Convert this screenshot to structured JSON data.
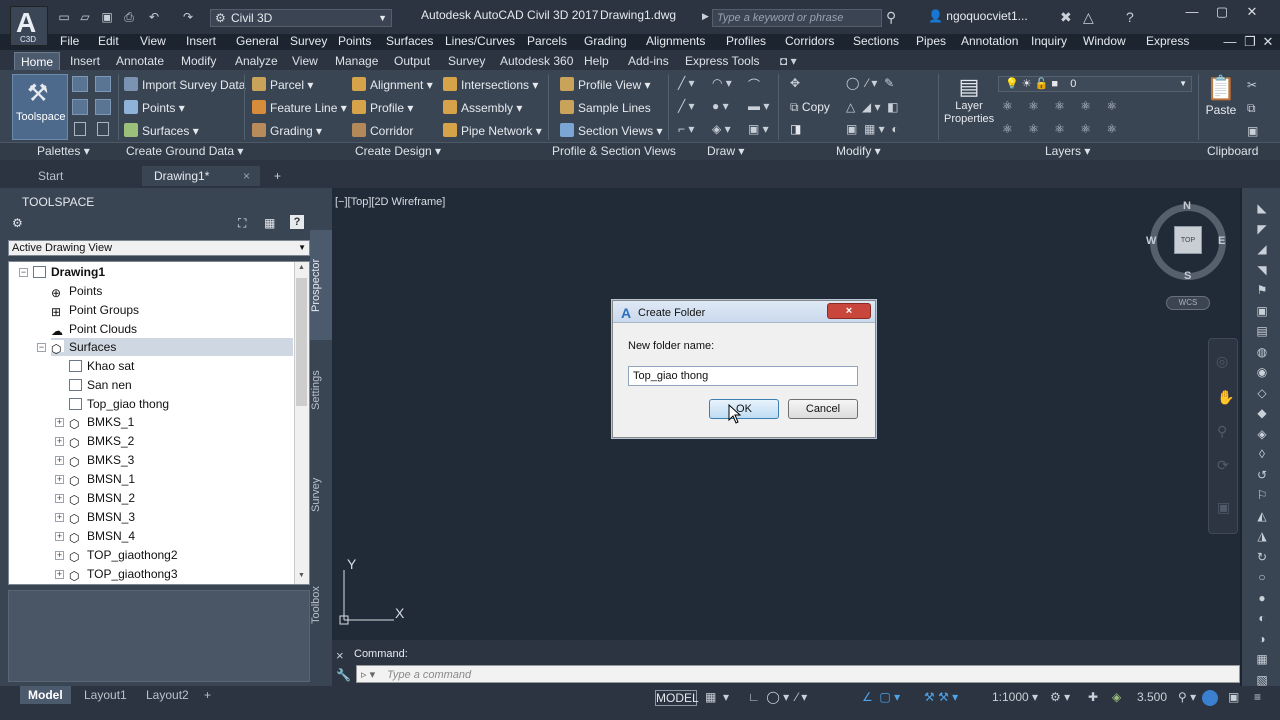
{
  "title": {
    "workspace": "Civil 3D",
    "app": "Autodesk AutoCAD Civil 3D 2017",
    "doc": "Drawing1.dwg",
    "search": "Type a keyword or phrase",
    "user": "ngoquocviet1...",
    "logo": "A",
    "logo_sub": "C3D"
  },
  "menus": [
    "File",
    "Edit",
    "View",
    "Insert",
    "General",
    "Survey",
    "Points",
    "Surfaces",
    "Lines/Curves",
    "Parcels",
    "Grading",
    "Alignments",
    "Profiles",
    "Corridors",
    "Sections",
    "Pipes",
    "Annotation",
    "Inquiry",
    "Window",
    "Express"
  ],
  "ribbon_tabs": [
    "Home",
    "Insert",
    "Annotate",
    "Modify",
    "Analyze",
    "View",
    "Manage",
    "Output",
    "Survey",
    "Autodesk 360",
    "Help",
    "Add-ins",
    "Express Tools"
  ],
  "ribbon": {
    "toolspace": "Toolspace",
    "ground": {
      "import": "Import Survey Data",
      "points": "Points",
      "surfaces": "Surfaces"
    },
    "design": {
      "parcel": "Parcel",
      "feature": "Feature Line",
      "grading": "Grading",
      "alignment": "Alignment",
      "profile": "Profile",
      "corridor": "Corridor",
      "intersections": "Intersections",
      "assembly": "Assembly",
      "pipe": "Pipe Network"
    },
    "profsec": {
      "profile_view": "Profile View",
      "sample": "Sample Lines",
      "section_views": "Section Views"
    },
    "modify": {
      "copy": "Copy"
    },
    "layers": {
      "layer_props": "Layer Properties",
      "layer_value": "0"
    },
    "clipboard": {
      "paste": "Paste"
    },
    "footers": [
      "Palettes",
      "Create Ground Data",
      "Create Design",
      "Profile & Section Views",
      "Draw",
      "Modify",
      "Layers",
      "Clipboard"
    ]
  },
  "doc_tabs": {
    "start": "Start",
    "drawing": "Drawing1*",
    "close": "×",
    "add": "+"
  },
  "toolspace": {
    "title": "TOOLSPACE",
    "view": "Active Drawing View",
    "tree": [
      {
        "label": "Drawing1"
      },
      {
        "label": "Points"
      },
      {
        "label": "Point Groups"
      },
      {
        "label": "Point Clouds"
      },
      {
        "label": "Surfaces"
      },
      {
        "label": "Khao sat"
      },
      {
        "label": "San nen"
      },
      {
        "label": "Top_giao thong"
      },
      {
        "label": "BMKS_1"
      },
      {
        "label": "BMKS_2"
      },
      {
        "label": "BMKS_3"
      },
      {
        "label": "BMSN_1"
      },
      {
        "label": "BMSN_2"
      },
      {
        "label": "BMSN_3"
      },
      {
        "label": "BMSN_4"
      },
      {
        "label": "TOP_giaothong2"
      },
      {
        "label": "TOP_giaothong3"
      }
    ],
    "side_tabs": [
      "Prospector",
      "Settings",
      "Survey",
      "Toolbox"
    ]
  },
  "canvas": {
    "view_label": "[−][Top][2D Wireframe]",
    "ucs_x": "X",
    "ucs_y": "Y"
  },
  "viewcube": {
    "n": "N",
    "s": "S",
    "e": "E",
    "w": "W",
    "top": "TOP",
    "wcs": "WCS"
  },
  "command": {
    "label": "Command:",
    "placeholder": "Type a command",
    "close": "×"
  },
  "dialog": {
    "title": "Create Folder",
    "label": "New folder name:",
    "value": "Top_giao thong",
    "ok": "OK",
    "cancel": "Cancel",
    "close": "×",
    "icon": "A"
  },
  "status": {
    "tabs": [
      "Model",
      "Layout1",
      "Layout2"
    ],
    "add": "+",
    "model": "MODEL",
    "scale": "1:1000",
    "decimal": "3.500"
  },
  "colors": {
    "accent": "#2e6fc2",
    "canvas": "#212a37",
    "ribbon": "#3a4553"
  }
}
